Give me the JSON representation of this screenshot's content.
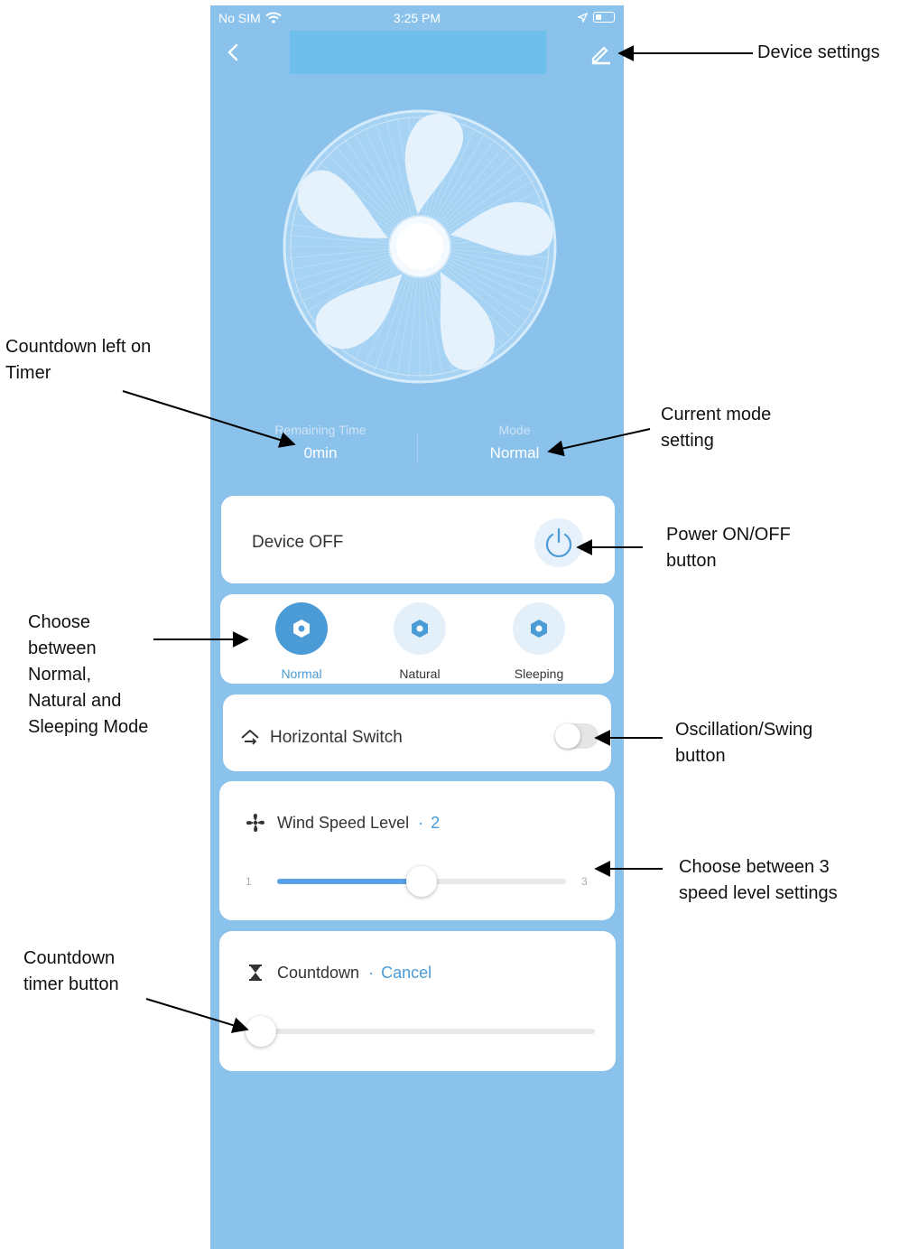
{
  "status_bar": {
    "carrier": "No SIM",
    "time": "3:25 PM"
  },
  "device": {
    "remaining_time_label": "Remaining Time",
    "remaining_time_value": "0min",
    "mode_label": "Mode",
    "mode_value": "Normal",
    "power_status": "Device OFF"
  },
  "modes": [
    {
      "label": "Normal",
      "active": true
    },
    {
      "label": "Natural",
      "active": false
    },
    {
      "label": "Sleeping",
      "active": false
    }
  ],
  "oscillation": {
    "label": "Horizontal Switch",
    "on": false
  },
  "wind_speed": {
    "label": "Wind Speed Level",
    "value": "2",
    "min": "1",
    "max": "3",
    "level_fraction": 0.5
  },
  "countdown": {
    "label": "Countdown",
    "action": "Cancel",
    "level_fraction": 0
  },
  "annotations": {
    "device_settings": "Device settings",
    "countdown_left_1": "Countdown left on",
    "countdown_left_2": "Timer",
    "current_mode_1": "Current mode",
    "current_mode_2": "setting",
    "power_1": "Power ON/OFF",
    "power_2": "button",
    "choose_mode_1": "Choose",
    "choose_mode_2": "between",
    "choose_mode_3": "Normal,",
    "choose_mode_4": "Natural and",
    "choose_mode_5": "Sleeping Mode",
    "osc_1": "Oscillation/Swing",
    "osc_2": "button",
    "speed_1": "Choose between 3",
    "speed_2": "speed level settings",
    "timer_1": "Countdown",
    "timer_2": "timer button"
  },
  "colors": {
    "app_background": "#8bc2ec",
    "accent": "#4b9bd6",
    "slider_fill": "#5aa2e6"
  }
}
